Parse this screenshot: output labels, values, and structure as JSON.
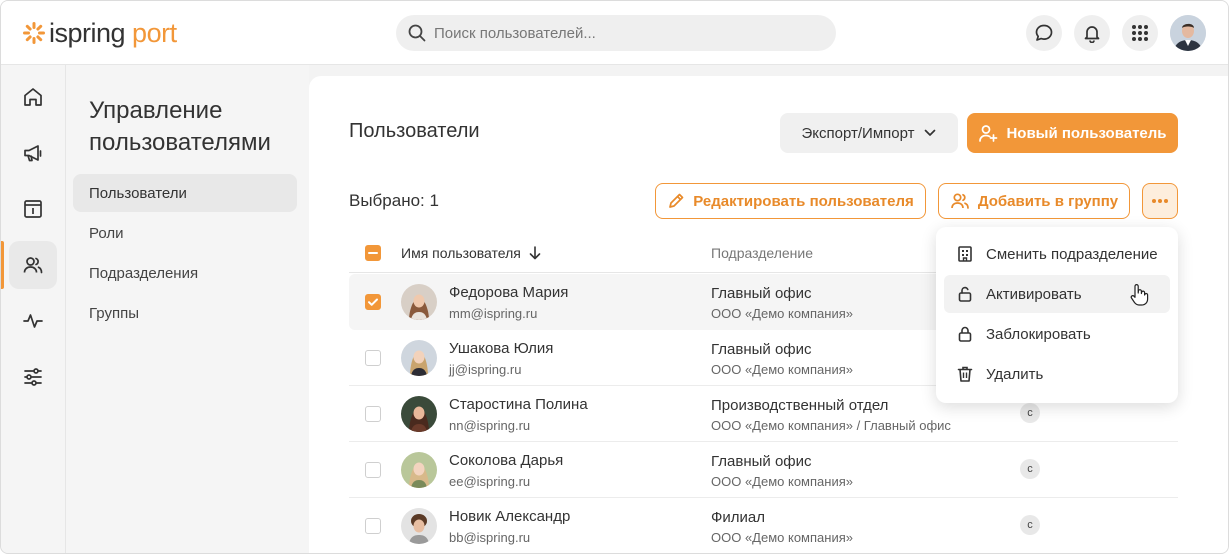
{
  "brand": {
    "part1": "ispring",
    "part2": "port",
    "accent": "#f29739"
  },
  "search": {
    "placeholder": "Поиск пользователей..."
  },
  "header_icons": [
    "chat-icon",
    "bell-icon",
    "apps-grid-icon",
    "user-avatar"
  ],
  "nav": {
    "items": [
      {
        "icon": "home-icon"
      },
      {
        "icon": "megaphone-icon"
      },
      {
        "icon": "catalog-icon"
      },
      {
        "icon": "users-icon",
        "active": true
      },
      {
        "icon": "activity-icon"
      },
      {
        "icon": "settings-sliders-icon"
      }
    ]
  },
  "sidebar": {
    "title": "Управление пользователями",
    "items": [
      {
        "label": "Пользователи",
        "active": true
      },
      {
        "label": "Роли"
      },
      {
        "label": "Подразделения"
      },
      {
        "label": "Группы"
      }
    ]
  },
  "main": {
    "title": "Пользователи",
    "export_label": "Экспорт/Импорт",
    "new_user_label": "Новый пользователь",
    "selected_label": "Выбрано: 1",
    "edit_label": "Редактировать пользователя",
    "add_group_label": "Добавить в группу"
  },
  "table": {
    "col_name": "Имя пользователя",
    "col_dept": "Подразделение",
    "rows": [
      {
        "name": "Федорова Мария",
        "email": "mm@ispring.ru",
        "dept": "Главный офис",
        "org": "ООО «Демо компания»",
        "selected": true,
        "badge": ""
      },
      {
        "name": "Ушакова Юлия",
        "email": "jj@ispring.ru",
        "dept": "Главный офис",
        "org": "ООО «Демо компания»",
        "selected": false,
        "badge": ""
      },
      {
        "name": "Старостина Полина",
        "email": "nn@ispring.ru",
        "dept": "Производственный отдел",
        "org": "ООО «Демо компания» / Главный офис",
        "selected": false,
        "badge": "с"
      },
      {
        "name": "Соколова Дарья",
        "email": "ee@ispring.ru",
        "dept": "Главный офис",
        "org": "ООО «Демо компания»",
        "selected": false,
        "badge": "с"
      },
      {
        "name": "Новик Александр",
        "email": "bb@ispring.ru",
        "dept": "Филиал",
        "org": "ООО «Демо компания»",
        "selected": false,
        "badge": "с"
      }
    ]
  },
  "menu": {
    "items": [
      {
        "label": "Сменить подразделение",
        "icon": "building-icon"
      },
      {
        "label": "Активировать",
        "icon": "unlock-icon",
        "hover": true
      },
      {
        "label": "Заблокировать",
        "icon": "lock-icon"
      },
      {
        "label": "Удалить",
        "icon": "trash-icon"
      }
    ]
  }
}
